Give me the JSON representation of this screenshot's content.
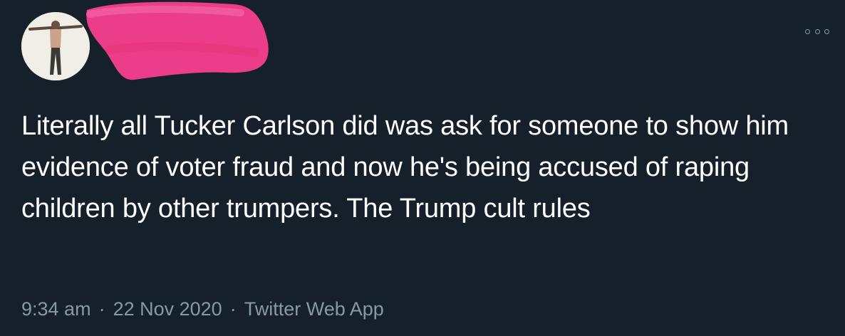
{
  "tweet": {
    "text": "Literally all Tucker Carlson did was ask for someone to show him evidence of voter fraud and now he's being accused of raping children by other trumpers. The Trump cult rules",
    "time": "9:34 am",
    "date": "22 Nov 2020",
    "source": "Twitter Web App",
    "separator": "·"
  },
  "author": {
    "avatar_icon": "profile-photo",
    "name_redacted": true,
    "handle_redacted": true
  },
  "icons": {
    "more": "more-options-icon"
  },
  "colors": {
    "background": "#15202b",
    "text": "#ffffff",
    "secondary": "#8899a6",
    "redaction": "#ec3d8a"
  }
}
